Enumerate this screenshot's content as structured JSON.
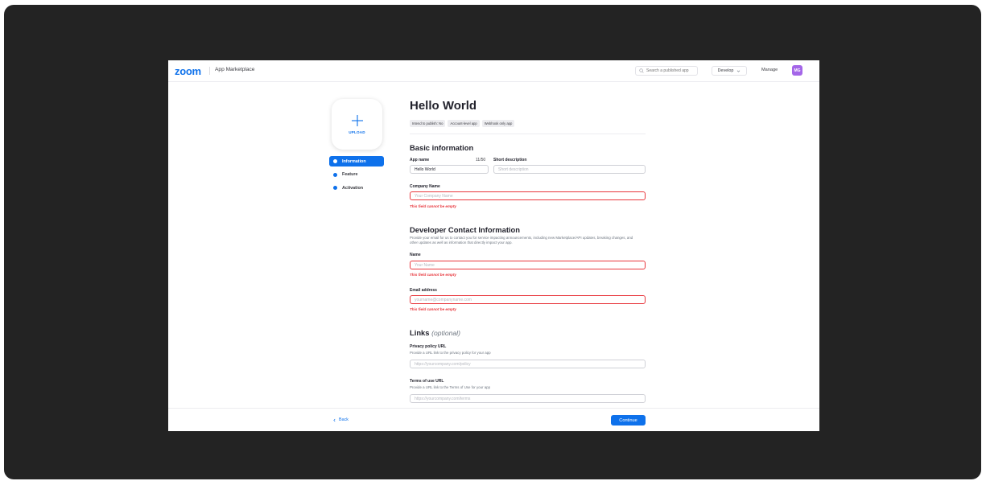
{
  "header": {
    "logo": "zoom",
    "app_title": "App Marketplace",
    "search_placeholder": "Search a published app",
    "develop_label": "Develop",
    "manage_label": "Manage",
    "avatar_initials": "MG"
  },
  "upload": {
    "label": "UPLOAD"
  },
  "steps": [
    {
      "label": "Information",
      "active": true
    },
    {
      "label": "Feature",
      "active": false
    },
    {
      "label": "Activation",
      "active": false
    }
  ],
  "app": {
    "title": "Hello World",
    "tags": [
      "Intend to publish: No",
      "Account-level app",
      "Webhook only app"
    ]
  },
  "basic": {
    "heading": "Basic information",
    "app_name_label": "App name",
    "app_name_value": "Hello World",
    "app_name_count": "11/50",
    "short_desc_label": "Short description",
    "short_desc_placeholder": "Short description",
    "company_label": "Company Name",
    "company_placeholder": "Your Company Name",
    "company_error": "This field cannot be empty"
  },
  "developer": {
    "heading": "Developer Contact Information",
    "description": "Provide your email for us to contact you for service impacting announcements, including new Marketplace/API updates, breaking changes, and other updates as well as information that directly impact your app.",
    "name_label": "Name",
    "name_placeholder": "Your Name",
    "name_error": "This field cannot be empty",
    "email_label": "Email address",
    "email_placeholder": "yourname@companyname.com",
    "email_error": "This field cannot be empty"
  },
  "links": {
    "heading": "Links",
    "heading_optional": "(optional)",
    "privacy_label": "Privacy policy URL",
    "privacy_desc": "Provide a URL link to the privacy policy for your app",
    "privacy_placeholder": "https://yourcompany.com/policy",
    "terms_label": "Terms of use URL",
    "terms_desc": "Provide a URL link to the Terms of Use for your app",
    "terms_placeholder": "https://yourcompany.com/terms"
  },
  "footer": {
    "back_label": "Back",
    "continue_label": "Continue"
  },
  "colors": {
    "accent": "#0e71eb",
    "error": "#e8373d",
    "avatar": "#a466e8",
    "frame": "#232323"
  }
}
